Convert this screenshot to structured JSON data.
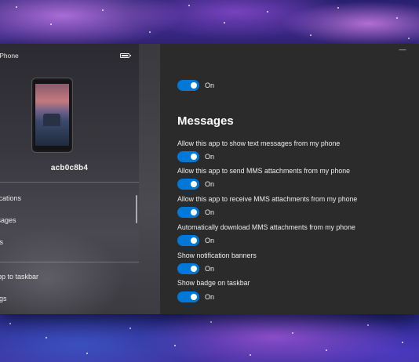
{
  "window": {
    "app_title": "r Phone",
    "minimize_glyph": "—"
  },
  "sidebar": {
    "device_name": "acb0c8b4",
    "nav_items": [
      {
        "label": "ifications"
      },
      {
        "label": "ssages"
      },
      {
        "label": "tos"
      },
      {
        "label": "app to taskbar"
      },
      {
        "label": "ings"
      }
    ]
  },
  "main": {
    "top_toggle": {
      "state": "On"
    },
    "section_title": "Messages",
    "settings": [
      {
        "label": "Allow this app to show text messages from my phone",
        "state": "On"
      },
      {
        "label": "Allow this app to send MMS attachments from my phone",
        "state": "On"
      },
      {
        "label": "Allow this app to receive MMS attachments from my phone",
        "state": "On"
      },
      {
        "label": "Automatically download MMS attachments from my phone",
        "state": "On"
      },
      {
        "label": "Show notification banners",
        "state": "On"
      },
      {
        "label": "Show badge on taskbar",
        "state": "On"
      }
    ]
  },
  "colors": {
    "accent": "#0078d7",
    "main_background": "#2b2b2b"
  }
}
